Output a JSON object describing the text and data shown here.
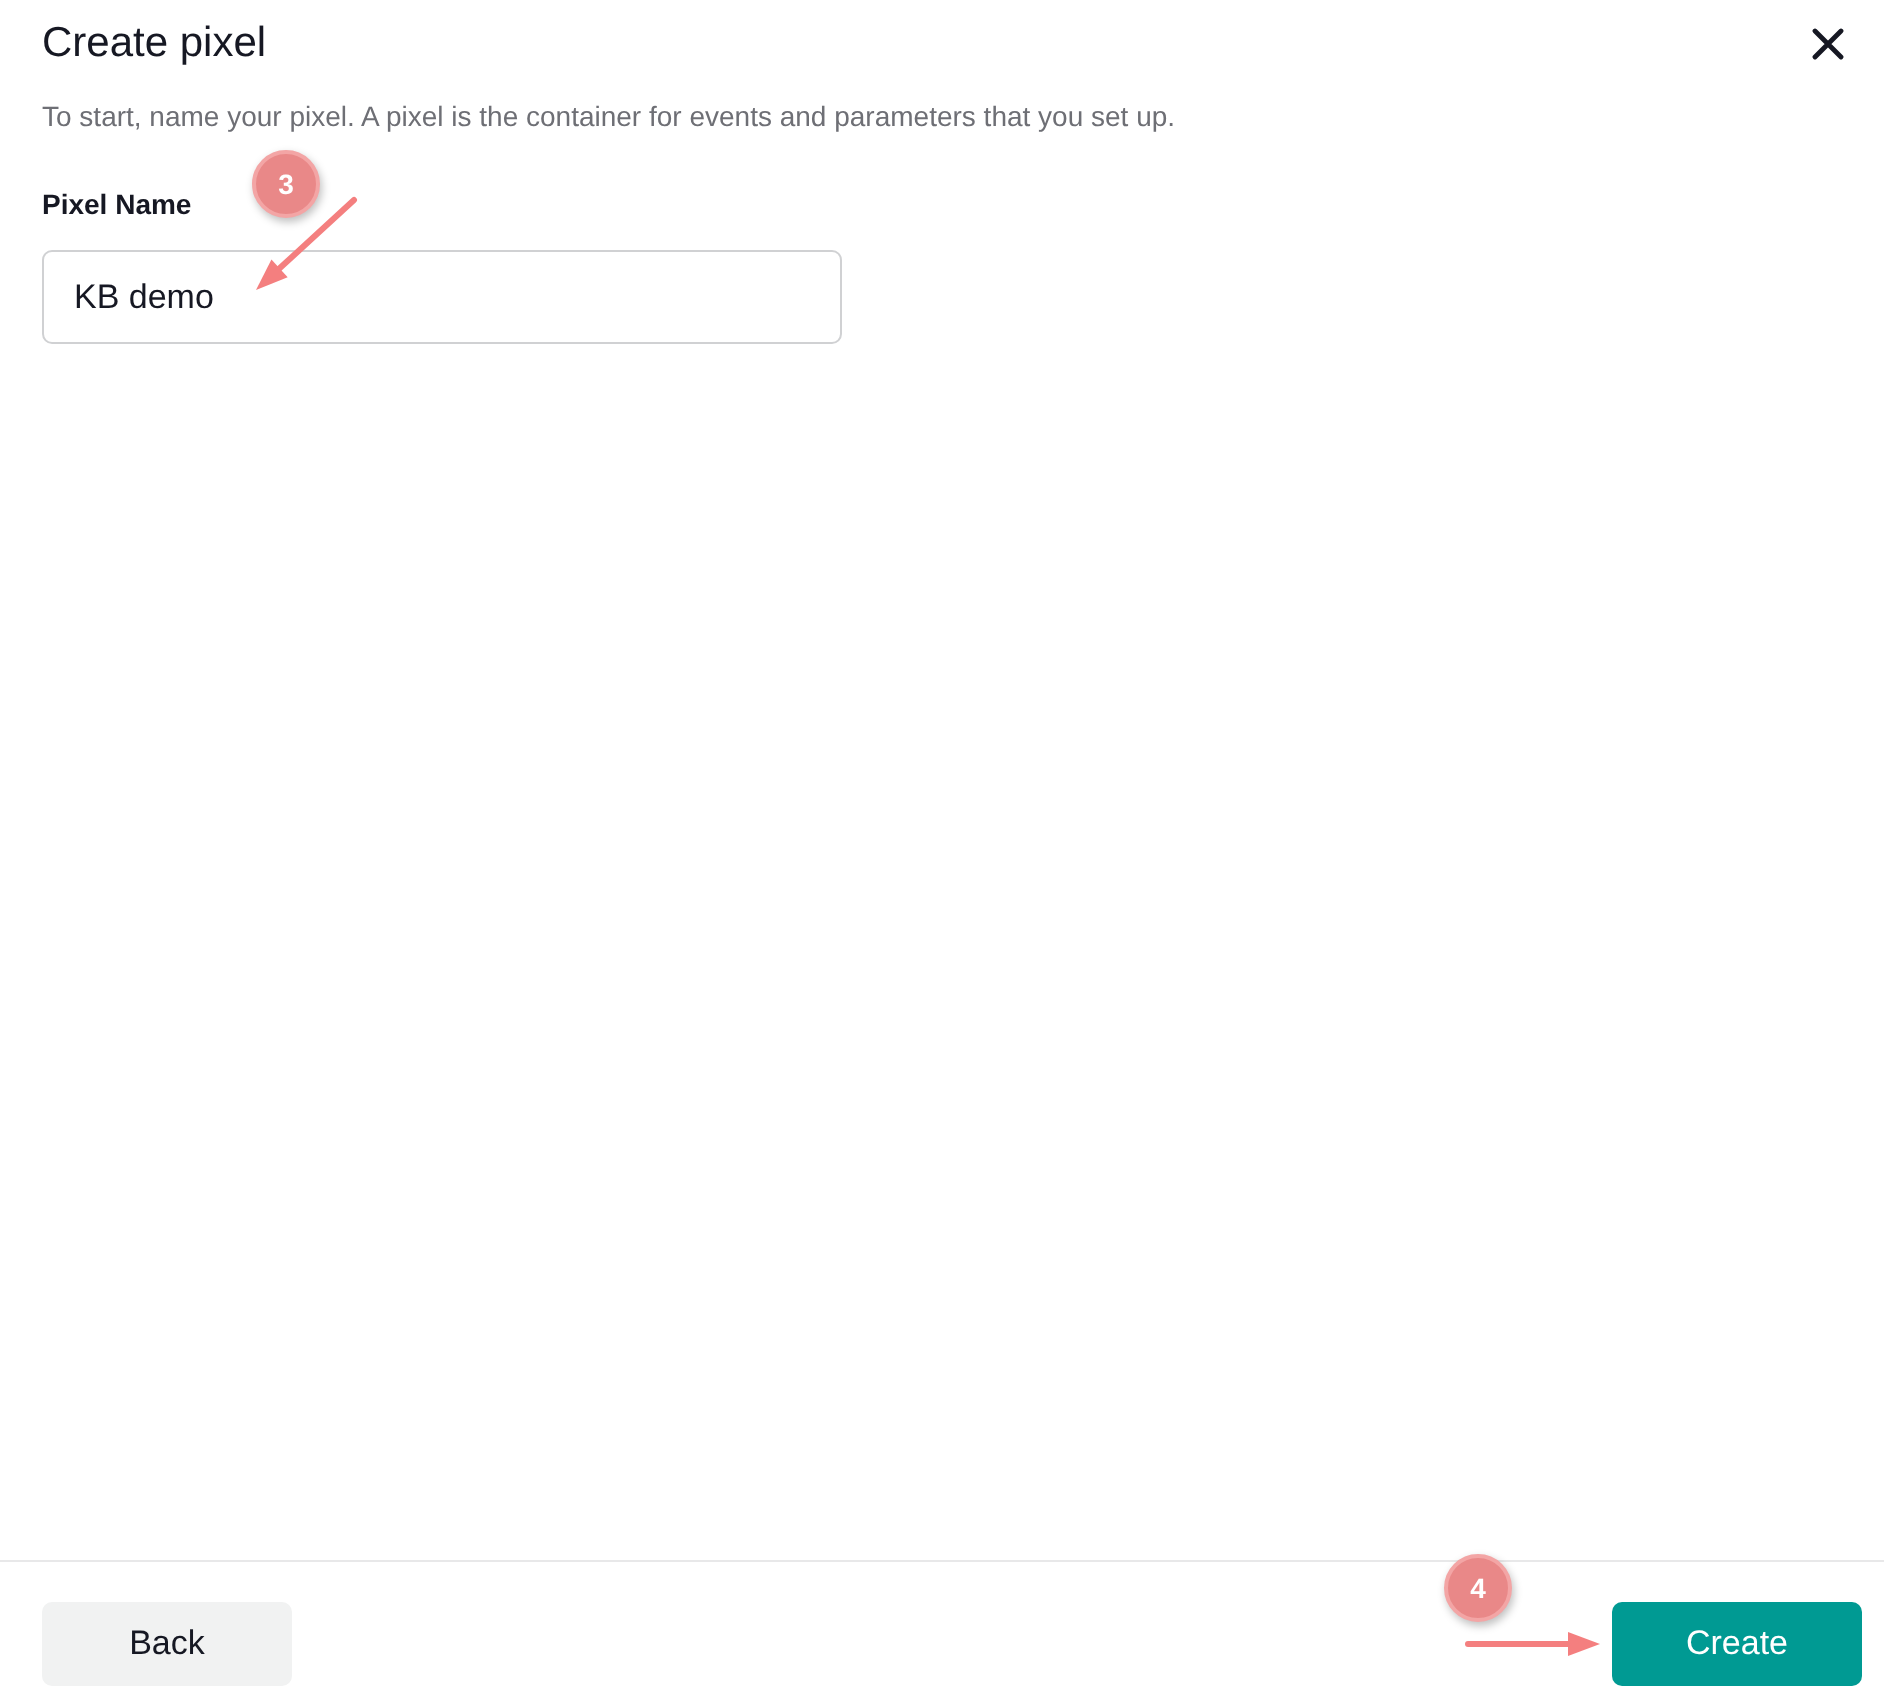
{
  "dialog": {
    "title": "Create pixel",
    "description": "To start, name your pixel. A pixel is the container for events and parameters that you set up."
  },
  "field": {
    "label": "Pixel Name",
    "value": "KB demo",
    "annotation": "3"
  },
  "buttons": [
    {
      "label": "Back",
      "kind": "secondary"
    },
    {
      "label": "Create",
      "kind": "primary",
      "annotation": "4"
    }
  ]
}
